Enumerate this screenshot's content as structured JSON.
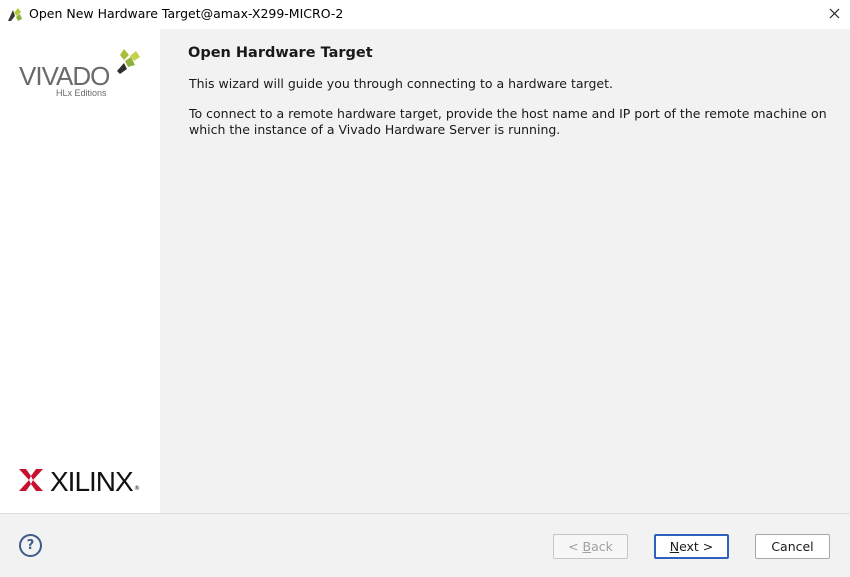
{
  "window": {
    "title": "Open New Hardware Target@amax-X299-MICRO-2",
    "app_icon": "vivado-icon",
    "close_icon": "close-icon"
  },
  "sidebar": {
    "vivado_logo": {
      "name": "VIVADO",
      "subtitle": "HLx Editions"
    },
    "xilinx_logo": {
      "name": "XILINX",
      "registered": "®"
    }
  },
  "main": {
    "heading": "Open Hardware Target",
    "paragraph1": "This wizard will guide you through connecting to a hardware target.",
    "paragraph2": "To connect to a remote hardware target, provide the host name and IP port of the remote machine on which the instance of a Vivado Hardware Server is running."
  },
  "footer": {
    "help_icon": "help-icon",
    "help_glyph": "?",
    "back": {
      "prefix": "< ",
      "mnemonic": "B",
      "rest": "ack",
      "enabled": false
    },
    "next": {
      "mnemonic": "N",
      "rest": "ext >",
      "enabled": true
    },
    "cancel": {
      "label": "Cancel",
      "enabled": true
    }
  },
  "colors": {
    "panel_bg": "#f2f2f2",
    "sidebar_bg": "#ffffff",
    "focus_border": "#2f5fbf",
    "help_blue": "#3d5a8a",
    "xilinx_red": "#c8102e",
    "vivado_green": "#8fb13a"
  }
}
